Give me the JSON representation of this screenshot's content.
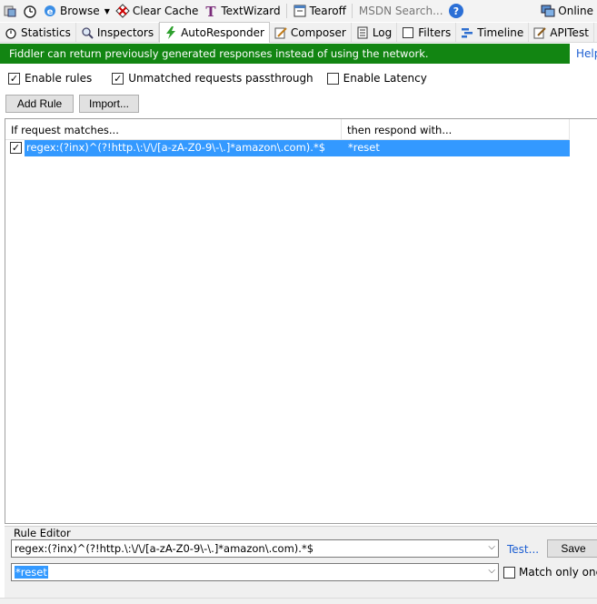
{
  "toolbar": {
    "browse": "Browse",
    "clear_cache": "Clear Cache",
    "text_wizard": "TextWizard",
    "tearoff": "Tearoff",
    "msdn_search": "MSDN Search...",
    "online": "Online"
  },
  "tabs": [
    {
      "label": "Statistics",
      "icon": "stopwatch-icon"
    },
    {
      "label": "Inspectors",
      "icon": "magnifier-icon"
    },
    {
      "label": "AutoResponder",
      "icon": "lightning-icon",
      "active": true
    },
    {
      "label": "Composer",
      "icon": "pencil-icon"
    },
    {
      "label": "Log",
      "icon": "document-icon"
    },
    {
      "label": "Filters",
      "icon": "checkbox-icon"
    },
    {
      "label": "Timeline",
      "icon": "timeline-icon"
    },
    {
      "label": "APITest",
      "icon": "edit-icon"
    }
  ],
  "banner": {
    "text": "Fiddler can return previously generated responses instead of using the network.",
    "help": "Help"
  },
  "options": {
    "enable_rules": {
      "label": "Enable rules",
      "checked": true
    },
    "unmatched": {
      "label": "Unmatched requests passthrough",
      "checked": true
    },
    "latency": {
      "label": "Enable Latency",
      "checked": false
    }
  },
  "buttons": {
    "add_rule": "Add Rule",
    "import": "Import..."
  },
  "rules": {
    "col_match": "If request matches...",
    "col_respond": "then respond with...",
    "items": [
      {
        "checked": true,
        "match": "regex:(?inx)^(?!http.\\:\\/\\/[a-zA-Z0-9\\-\\.]*amazon\\.com).*$",
        "respond": "*reset"
      }
    ]
  },
  "editor": {
    "label": "Rule Editor",
    "match_value": "regex:(?inx)^(?!http.\\:\\/\\/[a-zA-Z0-9\\-\\.]*amazon\\.com).*$",
    "respond_value": "*reset",
    "test": "Test...",
    "save": "Save",
    "match_once": "Match only once"
  },
  "colors": {
    "banner_bg": "#128512",
    "selection": "#3399ff",
    "link": "#1d5fd2"
  }
}
